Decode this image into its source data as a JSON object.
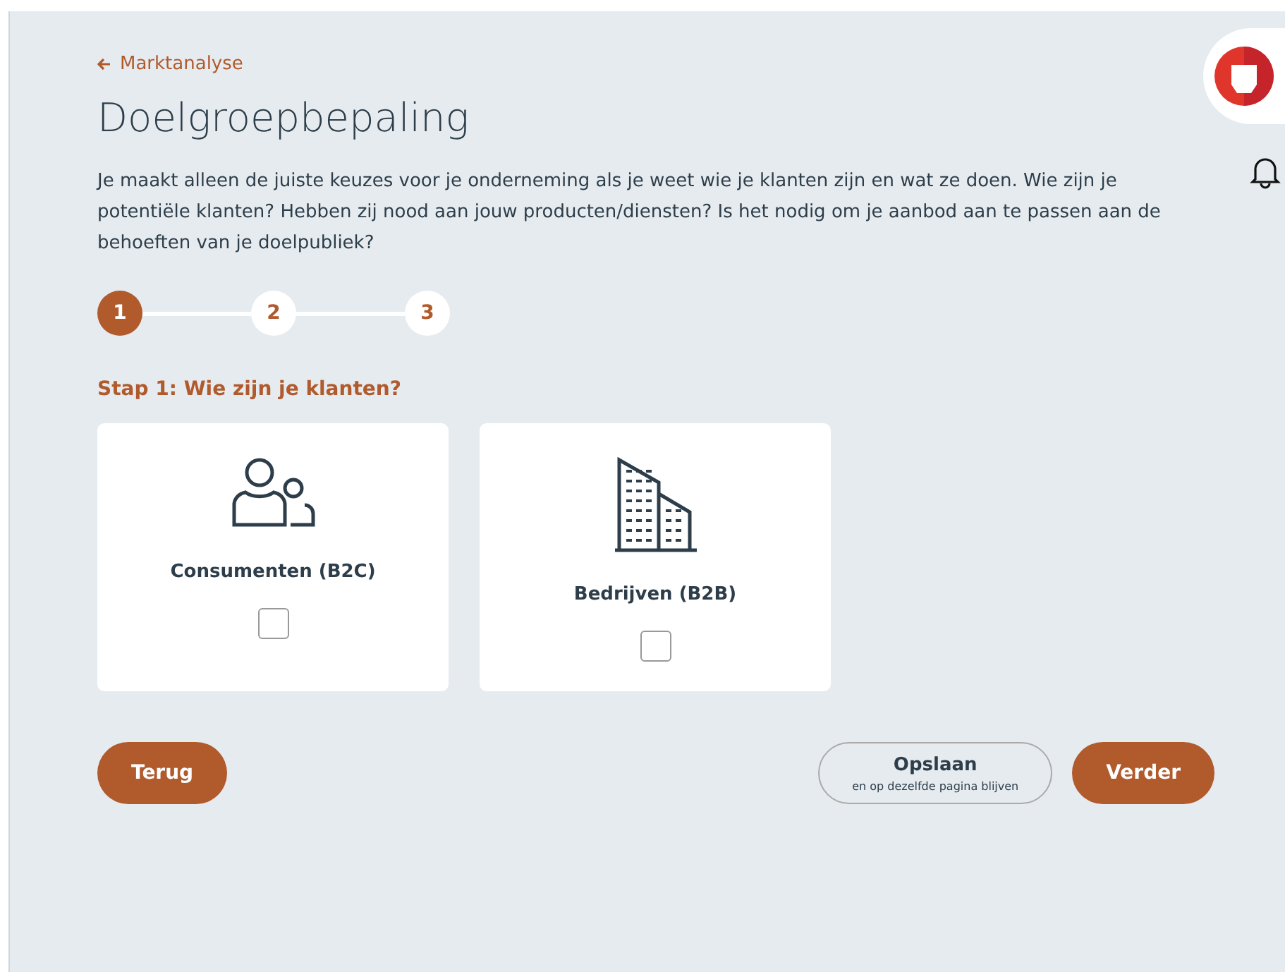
{
  "back_link": {
    "label": "Marktanalyse"
  },
  "title": "Doelgroepbepaling",
  "intro": "Je maakt alleen de juiste keuzes voor je onderneming als je weet wie je klanten zijn en wat ze doen. Wie zijn je potentiële klanten? Hebben zij nood aan jouw producten/diensten? Is het nodig om je aanbod aan te passen aan de behoeften van je doelpubliek?",
  "steps": [
    {
      "label": "1",
      "selected": true
    },
    {
      "label": "2",
      "selected": false
    },
    {
      "label": "3",
      "selected": false
    }
  ],
  "step_title": "Stap 1: Wie zijn je klanten?",
  "options": [
    {
      "kind": "people",
      "label": "Consumenten (B2C)",
      "checked": false
    },
    {
      "kind": "building",
      "label": "Bedrijven (B2B)",
      "checked": false
    }
  ],
  "buttons": {
    "back": "Terug",
    "save": {
      "label": "Opslaan",
      "sublabel": "en op dezelfde pagina blijven"
    },
    "next": "Verder"
  }
}
